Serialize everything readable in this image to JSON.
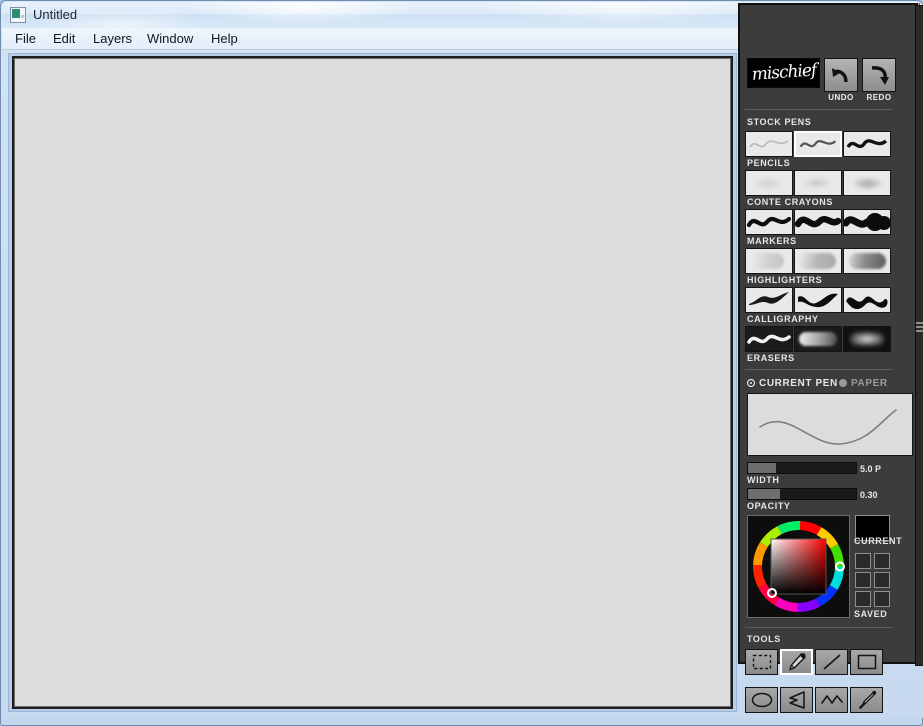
{
  "window": {
    "title": "Untitled",
    "icon": "app-icon",
    "buttons": {
      "minimize": "–",
      "maximize": "□",
      "close": "✕"
    }
  },
  "menubar": {
    "items": [
      {
        "label": "File"
      },
      {
        "label": "Edit"
      },
      {
        "label": "Layers"
      },
      {
        "label": "Window"
      },
      {
        "label": "Help"
      }
    ]
  },
  "panel": {
    "logo": "mischief",
    "undo": {
      "label": "UNDO",
      "icon": "undo-arrow-icon"
    },
    "redo": {
      "label": "REDO",
      "icon": "redo-arrow-icon"
    },
    "stock_pens_label": "STOCK PENS",
    "pen_groups": [
      {
        "label": "PENCILS",
        "selected_index": 1,
        "swatches": [
          "pencil-light",
          "pencil-medium",
          "pencil-dark"
        ]
      },
      {
        "label": "CONTE CRAYONS",
        "selected_index": -1,
        "swatches": [
          "conte-soft",
          "conte-blur",
          "conte-grain"
        ]
      },
      {
        "label": "MARKERS",
        "selected_index": -1,
        "swatches": [
          "marker-thin",
          "marker-thick",
          "marker-blob"
        ]
      },
      {
        "label": "HIGHLIGHTERS",
        "selected_index": -1,
        "swatches": [
          "highlighter-light",
          "highlighter-mid",
          "highlighter-dark"
        ]
      },
      {
        "label": "CALLIGRAPHY",
        "selected_index": -1,
        "swatches": [
          "calligraphy-thin",
          "calligraphy-angled",
          "calligraphy-bold"
        ]
      },
      {
        "label": "ERASERS",
        "selected_index": -1,
        "swatches": [
          "eraser-hard",
          "eraser-soft",
          "eraser-grain"
        ]
      }
    ],
    "current_pen": {
      "tab_pen_label": "CURRENT PEN",
      "tab_paper_label": "PAPER",
      "active_tab": "CURRENT PEN"
    },
    "width": {
      "label": "WIDTH",
      "value": "5.0 P",
      "fill_percent": 26
    },
    "opacity": {
      "label": "OPACITY",
      "value": "0.30",
      "fill_percent": 30
    },
    "color": {
      "current_label": "CURRENT",
      "saved_label": "SAVED",
      "current_swatch": "#000000",
      "hue_marker_color": "#ff0020",
      "sv_marker_color": "#000000",
      "saved_slots": [
        "",
        "",
        "",
        "",
        "",
        ""
      ]
    },
    "tools": {
      "label": "TOOLS",
      "selected_index": 1,
      "items": [
        {
          "name": "marquee-select-tool"
        },
        {
          "name": "pencil-tool"
        },
        {
          "name": "line-tool"
        },
        {
          "name": "rectangle-tool"
        },
        {
          "name": "ellipse-tool"
        },
        {
          "name": "polygon-tool"
        },
        {
          "name": "polyline-tool"
        },
        {
          "name": "eyedropper-tool"
        }
      ]
    },
    "scroll_grip": "panel-drag-grip"
  },
  "canvas": {
    "background": "#dcdcdc"
  }
}
